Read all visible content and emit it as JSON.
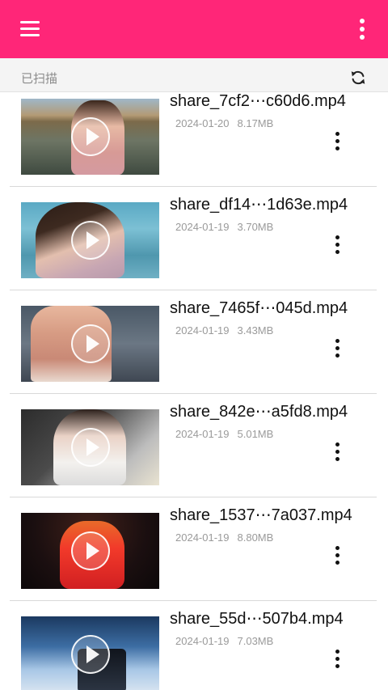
{
  "app": {
    "accent_color": "#ff2678",
    "menu_icon": "hamburger-menu-icon",
    "overflow_icon": "more-vertical-icon"
  },
  "status": {
    "label": "已扫描",
    "refresh_icon": "refresh-icon"
  },
  "videos": [
    {
      "name": "share_7cf2⋯c60d6.mp4",
      "date": "2024-01-20",
      "size": "8.17MB"
    },
    {
      "name": "share_df14⋯1d63e.mp4",
      "date": "2024-01-19",
      "size": "3.70MB"
    },
    {
      "name": "share_7465f⋯045d.mp4",
      "date": "2024-01-19",
      "size": "3.43MB"
    },
    {
      "name": "share_842e⋯a5fd8.mp4",
      "date": "2024-01-19",
      "size": "5.01MB"
    },
    {
      "name": "share_1537⋯7a037.mp4",
      "date": "2024-01-19",
      "size": "8.80MB"
    },
    {
      "name": "share_55d⋯507b4.mp4",
      "date": "2024-01-19",
      "size": "7.03MB"
    }
  ]
}
